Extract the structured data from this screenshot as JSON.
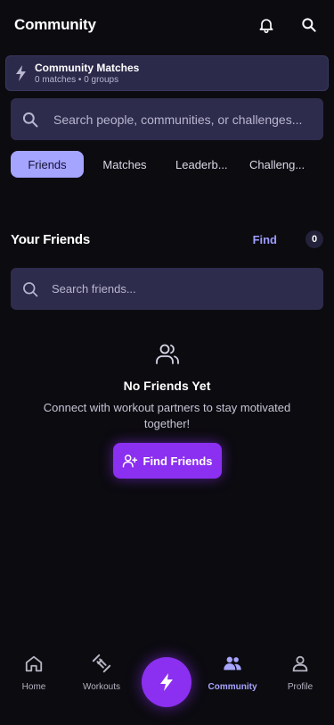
{
  "header": {
    "title": "Community",
    "notifications_icon": "bell-icon",
    "search_icon": "search-icon"
  },
  "banner": {
    "title": "Community Matches",
    "subtitle": "0 matches • 0 groups",
    "icon": "bolt-icon"
  },
  "search": {
    "placeholder": "Search people, communities, or challenges..."
  },
  "tabs": [
    {
      "label": "Friends",
      "active": true
    },
    {
      "label": "Matches",
      "active": false
    },
    {
      "label": "Leaderb...",
      "active": false
    },
    {
      "label": "Challeng...",
      "active": false
    }
  ],
  "friends": {
    "heading": "Your Friends",
    "find_label": "Find",
    "count": "0",
    "search_placeholder": "Search friends...",
    "empty_title": "No Friends Yet",
    "empty_description": "Connect with workout partners to stay motivated together!",
    "cta_label": "Find Friends"
  },
  "nav": {
    "items": [
      {
        "label": "Home",
        "icon": "home-icon"
      },
      {
        "label": "Workouts",
        "icon": "dumbbell-icon"
      },
      {
        "label": "Community",
        "icon": "people-icon",
        "active": true
      },
      {
        "label": "Profile",
        "icon": "user-icon"
      }
    ],
    "fab_icon": "bolt-icon"
  },
  "colors": {
    "accent": "#8b2ff0",
    "tab_active": "#a5a4ff",
    "link": "#9f9dff",
    "background": "#0c0b10",
    "surface": "#2e2c4c"
  }
}
